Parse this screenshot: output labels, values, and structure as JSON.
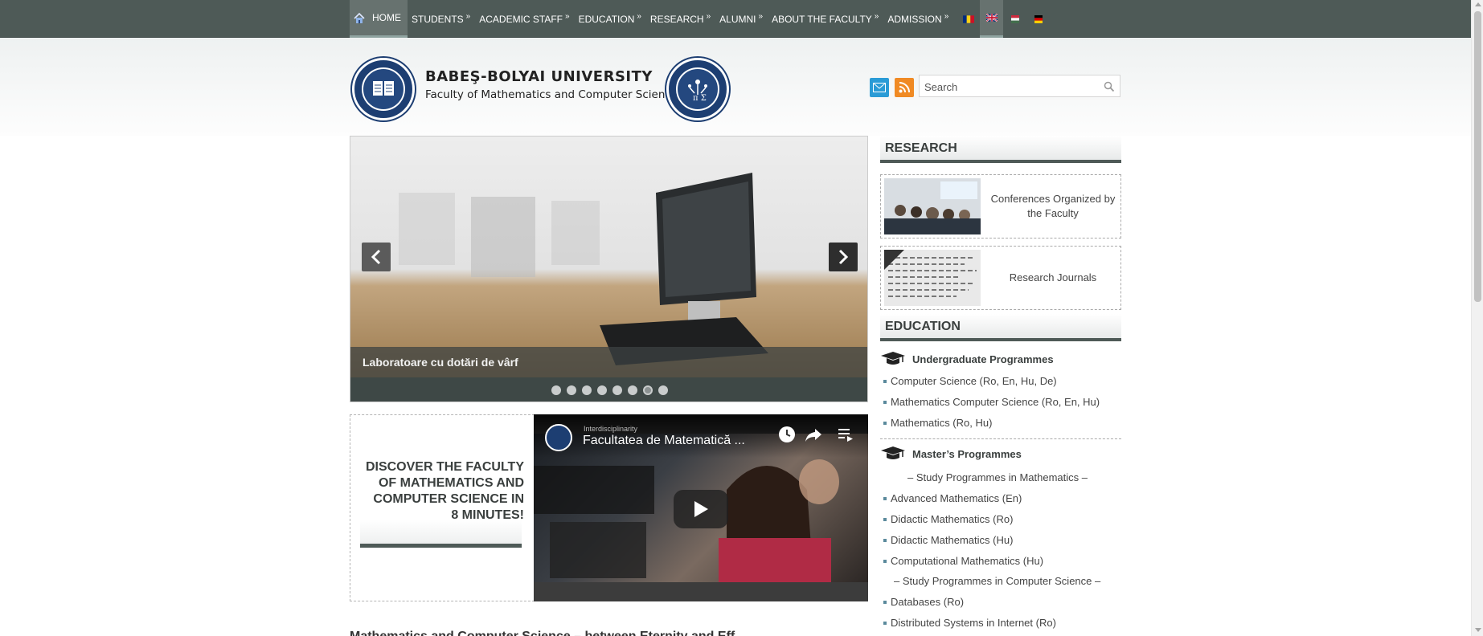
{
  "nav": {
    "items": [
      {
        "label": "HOME",
        "has_submenu": false,
        "active": true
      },
      {
        "label": "STUDENTS",
        "has_submenu": true
      },
      {
        "label": "ACADEMIC STAFF",
        "has_submenu": true
      },
      {
        "label": "EDUCATION",
        "has_submenu": true
      },
      {
        "label": "RESEARCH",
        "has_submenu": true
      },
      {
        "label": "ALUMNI",
        "has_submenu": true
      },
      {
        "label": "ABOUT THE FACULTY",
        "has_submenu": true
      },
      {
        "label": "ADMISSION",
        "has_submenu": true
      }
    ],
    "submenu_marker": "»",
    "languages": [
      "ro",
      "en",
      "hu",
      "de"
    ],
    "active_language": "en"
  },
  "header": {
    "university": "BABEŞ-BOLYAI UNIVERSITY",
    "faculty": "Faculty of Mathematics and Computer Science"
  },
  "search": {
    "placeholder": "Search"
  },
  "slider": {
    "caption": "Laboratoare cu dotări de vârf",
    "slide_count": 8,
    "active_slide": 7
  },
  "promo": {
    "text": "DISCOVER THE FACULTY OF MATHEMATICS AND COMPUTER SCIENCE IN 8 MINUTES!"
  },
  "video": {
    "channel": "Interdisciplinarity",
    "title": "Facultatea de Matematică ..."
  },
  "research": {
    "heading": "RESEARCH",
    "items": [
      {
        "label": "Conferences Organized by the Faculty"
      },
      {
        "label": "Research Journals"
      }
    ]
  },
  "education": {
    "heading": "EDUCATION",
    "undergrad": {
      "label": "Undergraduate Programmes",
      "items": [
        "Computer Science (Ro, En, Hu, De)",
        "Mathematics Computer Science (Ro, En, Hu)",
        "Mathematics (Ro, Hu)"
      ]
    },
    "masters": {
      "label": "Master’s Programmes",
      "math_subheading": "– Study Programmes in Mathematics –",
      "math_items": [
        "Advanced Mathematics (En)",
        "Didactic Mathematics (Ro)",
        "Didactic Mathematics (Hu)",
        "Computational Mathematics (Hu)"
      ],
      "cs_subheading": "– Study Programmes in Computer Science –",
      "cs_items": [
        "Databases (Ro)",
        "Distributed Systems in Internet (Ro)"
      ]
    }
  },
  "article": {
    "heading_partial": "Mathematics and Computer Science – between Eternity and Eff..."
  },
  "colors": {
    "nav_bg": "#4e5a57",
    "accent_bar": "#4e5a57",
    "seal_blue": "#1d3e72",
    "mail": "#2a9bd6",
    "rss": "#f08a24"
  }
}
